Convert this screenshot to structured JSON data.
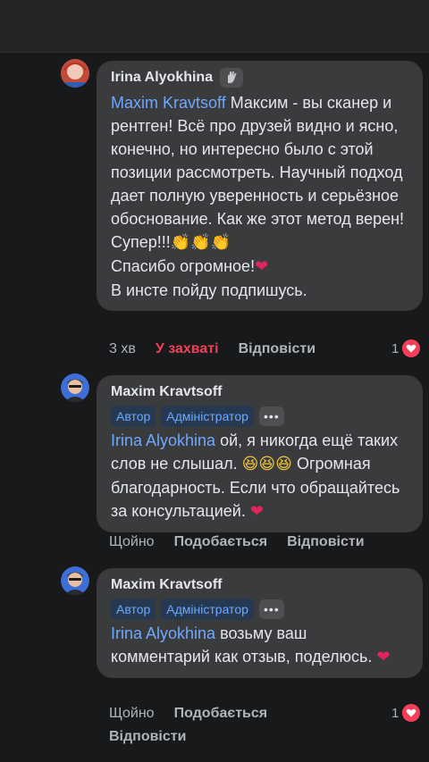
{
  "comments": [
    {
      "author": "Irina  Alyokhina",
      "mention": "Maxim Kravtsoff",
      "text_1": " Максим - вы сканер и рентген! Всё про друзей видно и ясно, конечно, но интересно было с этой позиции рассмотреть. Научный подход дает полную уверенность и серьёзное обоснование. Как же этот метод верен! Супер!!!",
      "clap_emoji": "👏👏👏",
      "text_2": "Спасибо огромное!",
      "heart_emoji": "❤",
      "text_3": "В инсте пойду подпишусь.",
      "time": "3 хв",
      "reaction_label": "У захваті",
      "reply_label": "Відповісти",
      "reaction_count": "1"
    },
    {
      "author": "Maxim Kravtsoff",
      "badge_1": "Автор",
      "badge_2": "Адміністратор",
      "more": "•••",
      "mention": "Irina  Alyokhina",
      "text_1": " ой, я никогда ещё таких слов не слышал. ",
      "laugh_emoji": "😆😆😆",
      "text_2": " Огромная благодарность. Если что обращайтесь за консультацией. ",
      "heart_emoji": "❤",
      "time": "Щойно",
      "like_label": "Подобається",
      "reply_label": "Відповісти"
    },
    {
      "author": "Maxim Kravtsoff",
      "badge_1": "Автор",
      "badge_2": "Адміністратор",
      "more": "•••",
      "mention": "Irina  Alyokhina",
      "text_1": " возьму ваш комментарий как отзыв, поделюсь. ",
      "heart_emoji": "❤",
      "time": "Щойно",
      "like_label": "Подобається",
      "reply_label": "Відповісти",
      "reaction_count": "1"
    }
  ]
}
